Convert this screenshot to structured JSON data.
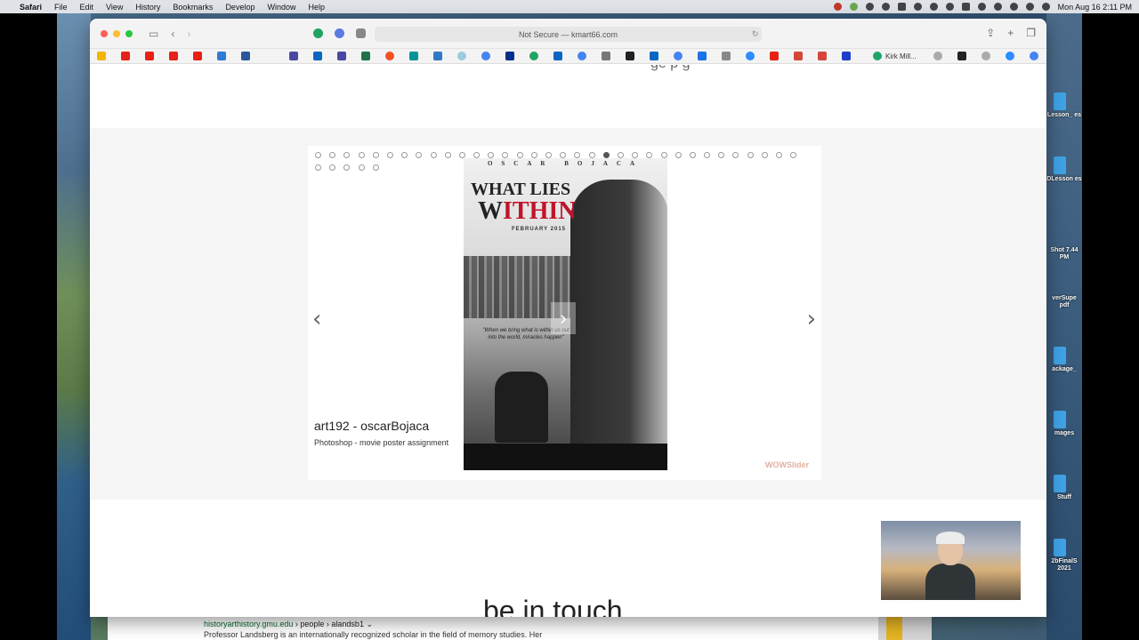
{
  "menubar": {
    "app": "Safari",
    "items": [
      "File",
      "Edit",
      "View",
      "History",
      "Bookmarks",
      "Develop",
      "Window",
      "Help"
    ],
    "clock": "Mon Aug 16  2:11 PM"
  },
  "browser": {
    "url": "Not Secure — kmart66.com",
    "favorite_label": "Kirk Mill..."
  },
  "page": {
    "top_partial_text": "ge p g",
    "slider": {
      "dot_count": 39,
      "active_dot": 20,
      "caption_title": "art192 - oscarBojaca",
      "caption_subtitle": "Photoshop - movie poster assignment",
      "watermark": "WOWSlider",
      "prev_arrow": "‹",
      "next_arrow": "›",
      "poster": {
        "credits": "OSCAR BOJACA",
        "title_line1": "WHAT LIES",
        "title_line2a": "W",
        "title_line2b": "ITHIN",
        "date": "FEBRUARY 2015",
        "quote": "\"When we bring what is within us out into the world, miracles happen\""
      }
    },
    "bottom_heading": "be in touch"
  },
  "desktop": {
    "items": [
      "Lesson_ es",
      "DLesson es",
      "Shot 7.44 PM",
      "verSupe pdf",
      "ackage_",
      "mages",
      "Stuff",
      "2bFinalS 2021"
    ]
  },
  "search_result": {
    "host": "historyarthistory.gmu.edu",
    "path": " › people › alandsb1 ⌄",
    "snippet": "Professor Landsberg is an internationally recognized scholar in the field of memory studies. Her"
  },
  "colors": {
    "accent_red": "#c0142a",
    "band": "#f5f5f5",
    "watermark": "#e0b0a0"
  }
}
